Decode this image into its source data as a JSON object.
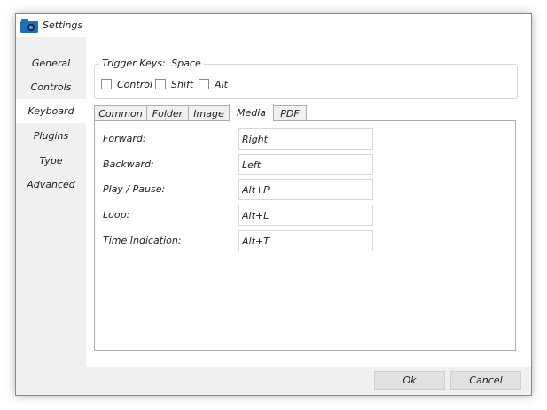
{
  "window": {
    "title": "Settings",
    "icon": "camera-folder-icon"
  },
  "sidebar": {
    "items": [
      {
        "label": "General"
      },
      {
        "label": "Controls"
      },
      {
        "label": "Keyboard",
        "active": true
      },
      {
        "label": "Plugins"
      },
      {
        "label": "Type"
      },
      {
        "label": "Advanced"
      }
    ]
  },
  "trigger": {
    "label": "Trigger Keys:",
    "value": "Space",
    "options": [
      {
        "label": "Control",
        "checked": false
      },
      {
        "label": "Shift",
        "checked": false
      },
      {
        "label": "Alt",
        "checked": false
      }
    ]
  },
  "tabs": [
    {
      "label": "Common"
    },
    {
      "label": "Folder"
    },
    {
      "label": "Image"
    },
    {
      "label": "Media",
      "active": true
    },
    {
      "label": "PDF"
    }
  ],
  "media_bindings": [
    {
      "label": "Forward:",
      "value": "Right"
    },
    {
      "label": "Backward:",
      "value": "Left"
    },
    {
      "label": "Play / Pause:",
      "value": "Alt+P"
    },
    {
      "label": "Loop:",
      "value": "Alt+L"
    },
    {
      "label": "Time Indication:",
      "value": "Alt+T"
    }
  ],
  "footer": {
    "ok_label": "Ok",
    "cancel_label": "Cancel"
  },
  "colors": {
    "accent": "#1e6fb8",
    "sidebar_bg": "#f0f0f0",
    "content_bg": "#ffffff"
  }
}
